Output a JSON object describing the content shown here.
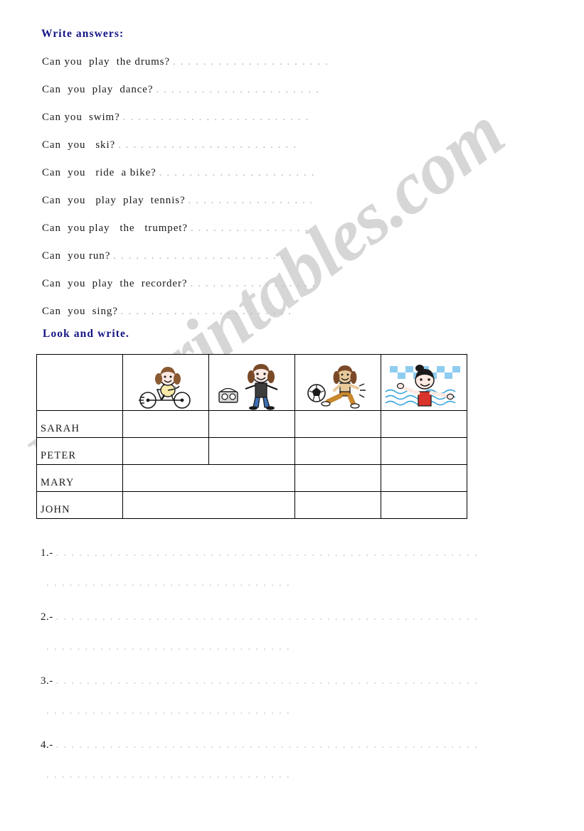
{
  "sections": {
    "write_answers": {
      "heading": "Write  answers:",
      "questions": [
        {
          "text": "Can you  play  the drums?",
          "dots_width": 225
        },
        {
          "text": "Can  you  play  dance?",
          "dots_width": 228
        },
        {
          "text": "Can you  swim?",
          "dots_width": 264
        },
        {
          "text": "Can  you   ski?",
          "dots_width": 250
        },
        {
          "text": "Can  you   ride  a bike?",
          "dots_width": 217
        },
        {
          "text": "Can  you   play  play  tennis?",
          "dots_width": 173
        },
        {
          "text": "Can  you play   the   trumpet?",
          "dots_width": 167
        },
        {
          "text": "Can  you run?",
          "dots_width": 239
        },
        {
          "text": "Can  you  play  the  recorder?",
          "dots_width": 176
        },
        {
          "text": "Can  you  sing?",
          "dots_width": 240
        }
      ]
    },
    "look_and_write": {
      "heading": "Look  and  write.",
      "table": {
        "header_row": {
          "corner_label": "",
          "pictures": [
            {
              "icon": "girl-riding-bicycle-icon",
              "alt": "ride a bike"
            },
            {
              "icon": "girl-dancing-with-radio-icon",
              "alt": "dance"
            },
            {
              "icon": "child-playing-football-icon",
              "alt": "play football"
            },
            {
              "icon": "girl-swimming-in-pool-icon",
              "alt": "swim"
            }
          ]
        },
        "rows": [
          {
            "name": "SARAH",
            "merged": false
          },
          {
            "name": "PETER",
            "merged": false
          },
          {
            "name": "MARY",
            "merged": true
          },
          {
            "name": "JOHN",
            "merged": true
          }
        ]
      },
      "answer_items": [
        {
          "number": "1.-",
          "line1_width": 594,
          "line2_width": 350
        },
        {
          "number": "2.-",
          "line1_width": 594,
          "line2_width": 344
        },
        {
          "number": "3.-",
          "line1_width": 594,
          "line2_width": 350
        },
        {
          "number": "4.-",
          "line1_width": 594,
          "line2_width": 344
        }
      ]
    }
  },
  "watermark": {
    "text": "ESLprintables.com",
    "color": "#c9c9c9"
  },
  "colors": {
    "heading": "#151585",
    "body_text": "#1a1a1a",
    "dots": "#b3b3b3",
    "table_border": "#000000"
  }
}
